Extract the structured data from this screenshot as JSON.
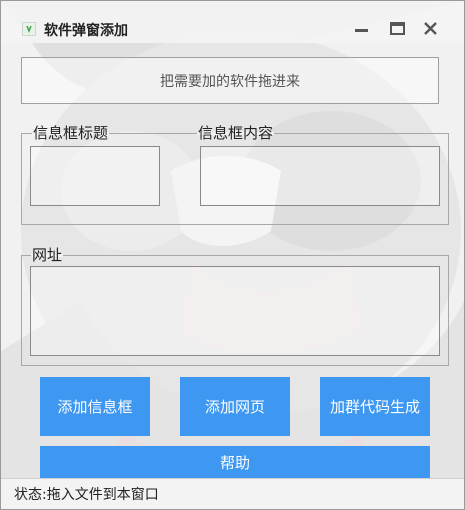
{
  "window": {
    "title": "软件弹窗添加"
  },
  "dropzone": {
    "text": "把需要加的软件拖进来"
  },
  "info_group": {
    "title_label": "信息框标题",
    "content_label": "信息框内容"
  },
  "url_group": {
    "label": "网址"
  },
  "buttons": {
    "add_info": "添加信息框",
    "add_webpage": "添加网页",
    "gen_group_code": "加群代码生成",
    "help": "帮助"
  },
  "status": {
    "text": "状态:拖入文件到本窗口"
  },
  "colors": {
    "button_blue": "#3e97f0",
    "window_bg": "#f1f1f1"
  }
}
